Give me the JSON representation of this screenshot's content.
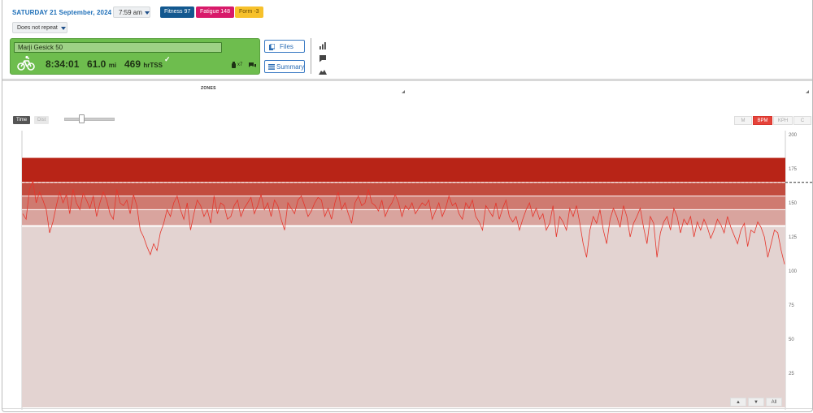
{
  "header": {
    "date": "SATURDAY 21 September, 2024",
    "time": "7:59 am",
    "fitness": "Fitness 97",
    "fatigue": "Fatigue 148",
    "form": "Form -3",
    "repeat": "Does not repeat"
  },
  "workout": {
    "title": "Marji Gesick 50",
    "duration": "8:34:01",
    "distance": "61.0",
    "distance_unit": "mi",
    "load": "469",
    "load_unit": "hrTSS",
    "equipment_count": "x7",
    "color": "#6ebd4e"
  },
  "buttons": {
    "files": "Files",
    "summary": "Summary"
  },
  "zones_label": "ZONES",
  "axis_toggle": {
    "time": "Time",
    "dist": "Dist"
  },
  "metrics": [
    {
      "label": "M",
      "active": false
    },
    {
      "label": "BPM",
      "active": true
    },
    {
      "label": "KPH",
      "active": false
    },
    {
      "label": "C",
      "active": false
    }
  ],
  "nav": {
    "up": "▲",
    "down": "▼",
    "all": "All"
  },
  "chart_data": {
    "type": "line",
    "series": [
      {
        "values": [
          142,
          138,
          160,
          166,
          150,
          158,
          152,
          145,
          128,
          136,
          148,
          158,
          150,
          156,
          142,
          160,
          150,
          145,
          157,
          152,
          146,
          155,
          140,
          150,
          158,
          152,
          142,
          138,
          160,
          150,
          148,
          152,
          142,
          156,
          148,
          130,
          125,
          118,
          112,
          120,
          115,
          128,
          135,
          145,
          140,
          150,
          155,
          145,
          138,
          150,
          130,
          142,
          152,
          148,
          140,
          145,
          135,
          155,
          142,
          150,
          148,
          138,
          140,
          148,
          152,
          140,
          146,
          150,
          154,
          142,
          148,
          156,
          145,
          150,
          140,
          152,
          148,
          138,
          130,
          150,
          146,
          142,
          152,
          155,
          148,
          140,
          144,
          150,
          154,
          152,
          140,
          146,
          138,
          150,
          158,
          145,
          150,
          142,
          135,
          150,
          155,
          148,
          150,
          160,
          150,
          148,
          144,
          152,
          140,
          146,
          150,
          156,
          150,
          140,
          148,
          145,
          150,
          142,
          146,
          150,
          148,
          152,
          138,
          144,
          150,
          140,
          146,
          155,
          148,
          150,
          142,
          138,
          150,
          146,
          152,
          140,
          136,
          130,
          148,
          144,
          140,
          150,
          138,
          146,
          152,
          140,
          136,
          140,
          130,
          138,
          145,
          150,
          140,
          146,
          138,
          142,
          130,
          135,
          148,
          125,
          140,
          136,
          130,
          146,
          140,
          148,
          135,
          120,
          110,
          130,
          140,
          135,
          145,
          130,
          120,
          138,
          146,
          140,
          132,
          148,
          140,
          125,
          135,
          140,
          146,
          132,
          120,
          140,
          135,
          110,
          128,
          136,
          140,
          130,
          146,
          140,
          128,
          138,
          134,
          140,
          125,
          136,
          130,
          138,
          132,
          124,
          130,
          138,
          134,
          128,
          140,
          132,
          126,
          120,
          130,
          135,
          118,
          130,
          128,
          136,
          132,
          125,
          110,
          120,
          130,
          128,
          115,
          105
        ]
      }
    ],
    "y_ticks": [
      200,
      175,
      150,
      125,
      100,
      75,
      50,
      25
    ],
    "ylim": [
      0,
      200
    ],
    "threshold_line": 165,
    "zones": [
      {
        "from": 0,
        "to": 133,
        "color": "#e3d3d1"
      },
      {
        "from": 133,
        "to": 145,
        "color": "#d9a49e"
      },
      {
        "from": 145,
        "to": 155,
        "color": "#cf7a70"
      },
      {
        "from": 155,
        "to": 165,
        "color": "#c24c3f"
      },
      {
        "from": 165,
        "to": 183,
        "color": "#b82417"
      }
    ],
    "line_color": "#e5352b"
  }
}
